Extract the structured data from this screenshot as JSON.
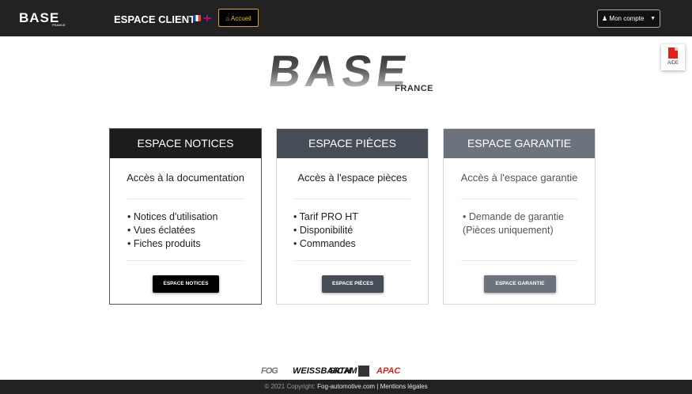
{
  "header": {
    "logo_text": "BASE",
    "logo_sub": "FRANCE",
    "brand": "ESPACE CLIENT",
    "home_label": "Accueil",
    "home_icon": "home-icon",
    "account_label": "Mon compte",
    "account_icon": "user-icon"
  },
  "aide": {
    "label": "AIDE",
    "icon": "pdf-icon"
  },
  "main_logo": {
    "word": "BASE",
    "sub": "FRANCE"
  },
  "cards": [
    {
      "title": "ESPACE NOTICES",
      "subtitle": "Accès à la documentation",
      "items": [
        "Notices d'utilisation",
        "Vues éclatées",
        "Fiches produits"
      ],
      "button": "ESPACE NOTICES",
      "color": "#1c1c1c"
    },
    {
      "title": "ESPACE PIÈCES",
      "subtitle": "Accès à l'espace pièces",
      "items": [
        "Tarif PRO HT",
        "Disponibilité",
        "Commandes"
      ],
      "button": "ESPACE PIÈCES",
      "color": "#474d57"
    },
    {
      "title": "ESPACE GARANTIE",
      "subtitle": "Accès à l'espace garantie",
      "items": [
        "Demande de garantie\n(Pièces uniquement)"
      ],
      "button": "ESPACE GARANTIE",
      "color": "#6c737c"
    }
  ],
  "brands": [
    "FOG",
    "WEISSBARTH",
    "SICAM",
    "APAC"
  ],
  "footer": {
    "copyright": "© 2021 Copyright: ",
    "link": "Fog-automotive.com",
    "sep": " | ",
    "legal": "Mentions légales"
  }
}
